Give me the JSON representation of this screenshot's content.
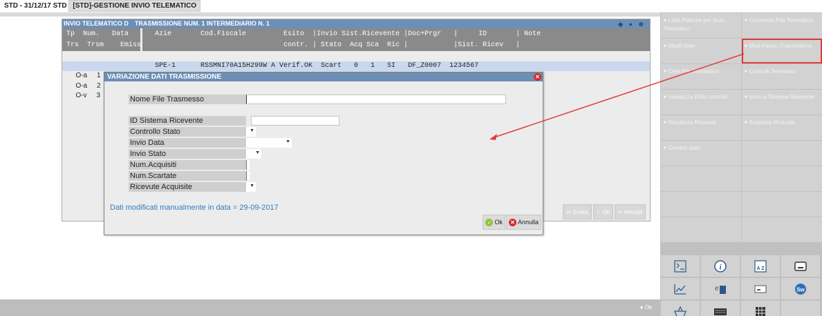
{
  "titlebar": {
    "prefix": "STD - 31/12/17 STD",
    "section": "[STD]-GESTIONE INVIO TELEMATICO"
  },
  "list_window": {
    "title_left": "INVIO TELEMATICO D",
    "title_right": "TRASMISSIONE NUM.  1 INTERMEDIARIO N.  1",
    "header_row1_left": " Tp  Num.   Data",
    "header_row1_right": "   Azie       Cod.Fiscale         Esito  |Invio Sist.Ricevente |Doc+Prgr   |     ID       | Note",
    "header_row2_left": " Trs  Trsm    Emiss",
    "header_row2_right": "                                  contr. | Stato  Acq Sca  Ric |           |Sist. Ricev   |",
    "rows": [
      {
        "left": " O-a     1   11/09/1",
        "right": "   SPE-1      RSSMNI70A15H299W A Verif.OK  Scart   0   1   SI   DF_Z0007  1234567"
      },
      {
        "left": " O-a     2",
        "right": ""
      },
      {
        "left": " O-v     3",
        "right": ""
      }
    ],
    "buttons": {
      "scelta": "Scelta",
      "ok": "Ok",
      "annulla": "Annulla"
    }
  },
  "dialog": {
    "title": "VARIAZIONE DATI TRASMISSIONE",
    "fields": {
      "nome_file": "Nome File Trasmesso",
      "id_sistema": "ID Sistema Ricevente",
      "controllo_stato": "Controllo Stato",
      "invio_data": "Invio Data",
      "invio_stato": "Invio Stato",
      "num_acquisiti": "Num.Acquisiti",
      "num_scartate": "Num.Scartate",
      "ricevute_acquisite": "Ricevute Acquisite"
    },
    "note": "Dati modificati manualmente in data = 29-09-2017",
    "ok": "Ok",
    "annulla": "Annulla"
  },
  "right_panel": {
    "buttons": [
      "Lista Pratiche per Invio Telematico",
      "Contenuto File Telematico",
      "Modif.Note",
      "Mod.Param.Trasmissione",
      "Crea File Telematico",
      "Controlli Telematici",
      "Visualizza Esito controlli",
      "Invio al Sistema Ricevente",
      "Visualizza Ricevuta",
      "Acquisire Ricevute",
      "Cambio stato"
    ]
  },
  "statusbar": {
    "ok": "Ok"
  },
  "colors": {
    "title_blue": "#6c8fb5",
    "highlight_red": "#e03a3a",
    "note_blue": "#2d7fc1",
    "selected_row": "#c9d8ee"
  },
  "icons": [
    "calculator-icon",
    "info-icon",
    "sort-az-icon",
    "player-icon",
    "chart-icon",
    "ep-icon",
    "keyboard-key-icon",
    "sw-icon",
    "basket-icon",
    "keyboard-icon",
    "grid-icon"
  ]
}
